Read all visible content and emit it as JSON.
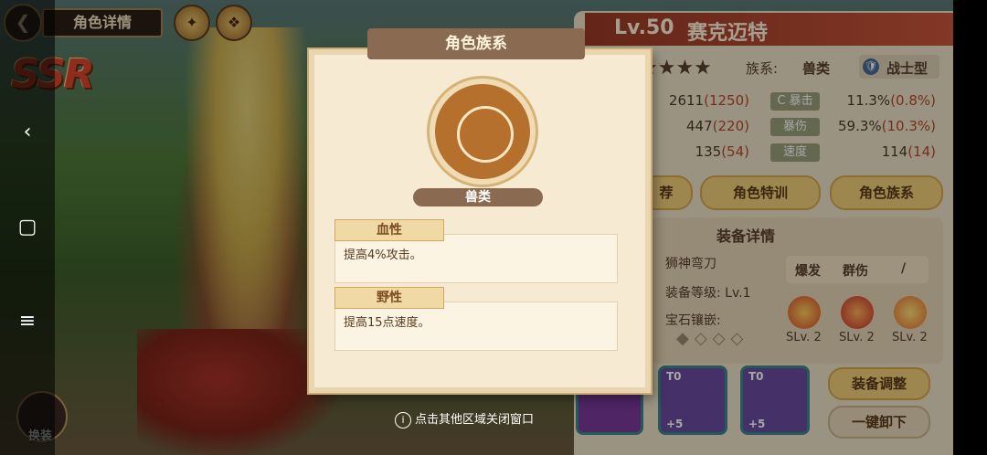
{
  "header": {
    "back_glyph": "❮",
    "title": "角色详情"
  },
  "rarity": "SSR",
  "nav": {
    "back": "‹",
    "home": "▢",
    "menu": "≡"
  },
  "swap_label": "换装",
  "character": {
    "level": "Lv.50",
    "name": "赛克迈特",
    "stars": "★★★★",
    "family_label": "族系:",
    "family_value": "兽类",
    "role_icon": "🛡",
    "role": "战士型",
    "stats": [
      {
        "base": "2611",
        "bonus": "(1250)",
        "tag": "C 暴击",
        "value": "11.3%",
        "value_bonus": "(0.8%)"
      },
      {
        "base": "447",
        "bonus": "(220)",
        "tag": "暴伤",
        "value": "59.3%",
        "value_bonus": "(10.3%)"
      },
      {
        "base": "135",
        "bonus": "(54)",
        "tag": "速度",
        "value": "114",
        "value_bonus": "(14)"
      }
    ],
    "buttons": {
      "b1": "荐",
      "b2": "角色特训",
      "b3": "角色族系"
    }
  },
  "equipment": {
    "title": "装备详情",
    "name": "狮神弯刀",
    "level": "装备等级: Lv.1",
    "gem": "宝石镶嵌:",
    "tags": [
      "爆发",
      "群伤",
      "/"
    ],
    "skills": [
      "SLv. 2",
      "SLv. 2",
      "SLv. 2"
    ],
    "slots": [
      {
        "t": "T0",
        "p": "+5"
      },
      {
        "t": "T0",
        "p": "+5"
      }
    ],
    "adjust": "装备调整",
    "unequip": "一键卸下"
  },
  "modal": {
    "title": "角色族系",
    "family": "兽类",
    "traits": [
      {
        "name": "血性",
        "desc": "提高4%攻击。"
      },
      {
        "name": "野性",
        "desc": "提高15点速度。"
      }
    ],
    "hint_icon": "i",
    "hint": "点击其他区域关闭窗口"
  }
}
